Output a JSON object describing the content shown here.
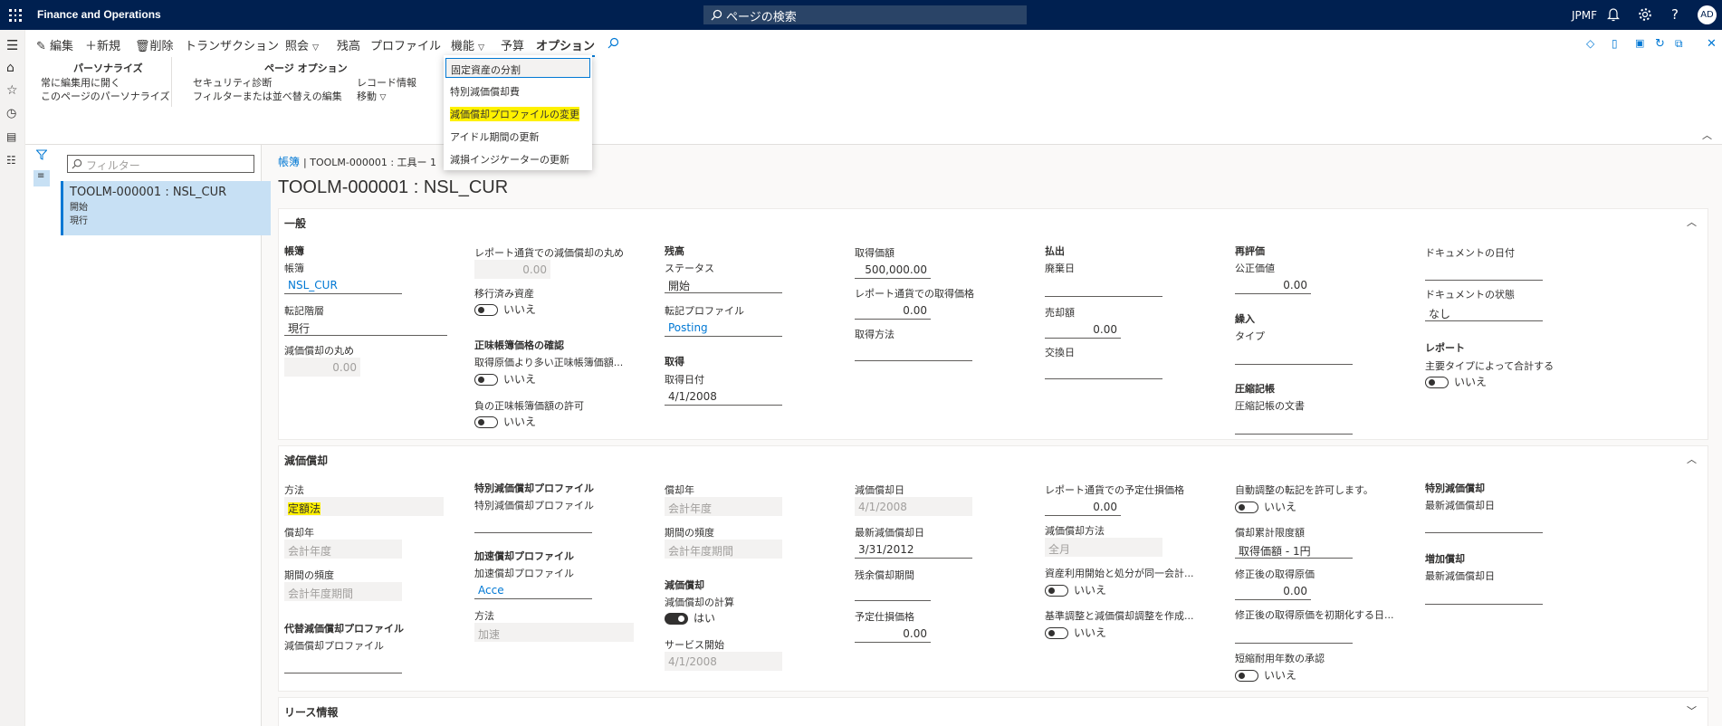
{
  "topbar": {
    "app_name": "Finance and Operations",
    "search_placeholder": "ページの検索",
    "company": "JPMF",
    "avatar": "AD"
  },
  "actions": {
    "edit": "編集",
    "new": "新規",
    "delete": "削除",
    "transaction": "トランザクション",
    "inquiry": "照会",
    "balance": "残高",
    "profile": "プロファイル",
    "function": "機能",
    "budget": "予算",
    "options": "オプション"
  },
  "options_pane": {
    "personalize_title": "パーソナライズ",
    "always_open_edit": "常に編集用に開く",
    "personalize_page": "このページのパーソナライズ",
    "page_options_title": "ページ オプション",
    "security_diagnostics": "セキュリティ診断",
    "filter_sort": "フィルターまたは並べ替えの編集",
    "record_info": "レコード情報",
    "move": "移動"
  },
  "function_menu": {
    "items": [
      "固定資産の分割",
      "特別減価償却費",
      "減価償却プロファイルの変更",
      "アイドル期間の更新",
      "減損インジケーターの更新"
    ]
  },
  "list": {
    "filter_placeholder": "フィルター",
    "item_title": "TOOLM-000001 : NSL_CUR",
    "item_line1": "開始",
    "item_line2": "現行"
  },
  "breadcrumb": {
    "link": "帳簿",
    "path": "TOOLM-000001 : 工具ー 1"
  },
  "page_title": "TOOLM-000001 : NSL_CUR",
  "general": {
    "title": "一般",
    "book_group": "帳簿",
    "book_label": "帳簿",
    "book_value": "NSL_CUR",
    "posting_layer_label": "転記階層",
    "posting_layer_value": "現行",
    "dep_rounding_label": "減価償却の丸め",
    "dep_rounding_value": "0.00",
    "report_rounding_label": "レポート通貨での減価償却の丸め",
    "report_rounding_value": "0.00",
    "migrated_label": "移行済み資産",
    "migrated_value": "いいえ",
    "nbv_group": "正味帳簿価格の確認",
    "nbv_greater_label": "取得原価より多い正味帳簿価額...",
    "nbv_greater_value": "いいえ",
    "nbv_negative_label": "負の正味帳簿価額の許可",
    "nbv_negative_value": "いいえ",
    "balance_group": "残高",
    "status_label": "ステータス",
    "status_value": "開始",
    "posting_profile_label": "転記プロファイル",
    "posting_profile_value": "Posting",
    "acq_group": "取得",
    "acq_date_label": "取得日付",
    "acq_date_value": "4/1/2008",
    "acq_price_label": "取得価額",
    "acq_price_value": "500,000.00",
    "report_acq_price_label": "レポート通貨での取得価格",
    "report_acq_price_value": "0.00",
    "acq_method_label": "取得方法",
    "acq_method_value": "",
    "disposal_group": "払出",
    "scrap_date_label": "廃棄日",
    "sale_amount_label": "売却額",
    "sale_amount_value": "0.00",
    "exchange_date_label": "交換日",
    "reval_group": "再評価",
    "fair_value_label": "公正価値",
    "fair_value_value": "0.00",
    "transfer_group": "繰入",
    "type_label": "タイプ",
    "compress_group": "圧縮記帳",
    "compress_doc_label": "圧縮記帳の文書",
    "doc_date_label": "ドキュメントの日付",
    "doc_status_label": "ドキュメントの状態",
    "doc_status_value": "なし",
    "report_group": "レポート",
    "sum_by_main_type_label": "主要タイプによって合計する",
    "sum_by_main_type_value": "いいえ"
  },
  "depreciation": {
    "title": "減価償却",
    "method_label": "方法",
    "method_value": "定額法",
    "dep_year_label": "償却年",
    "dep_year_value": "会計年度",
    "period_freq_label": "期間の頻度",
    "period_freq_value": "会計年度期間",
    "alt_group": "代替減価償却プロファイル",
    "alt_profile_label": "減価償却プロファイル",
    "special_group": "特別減価償却プロファイル",
    "special_profile_label": "特別減価償却プロファイル",
    "accel_group": "加速償却プロファイル",
    "accel_profile_label": "加速償却プロファイル",
    "accel_profile_value": "Acce",
    "accel_method_label": "方法",
    "accel_method_value": "加速",
    "dep_year2_label": "償却年",
    "dep_year2_value": "会計年度",
    "period_freq2_label": "期間の頻度",
    "period_freq2_value": "会計年度期間",
    "dep_group": "減価償却",
    "calc_dep_label": "減価償却の計算",
    "calc_dep_value": "はい",
    "service_start_label": "サービス開始",
    "service_start_value": "4/1/2008",
    "dep_date_label": "減価償却日",
    "dep_date_value": "4/1/2008",
    "last_dep_date_label": "最新減価償却日",
    "last_dep_date_value": "3/31/2012",
    "remaining_periods_label": "残余償却期間",
    "remaining_periods_value": "",
    "scrap_value_label": "予定仕損価格",
    "scrap_value_value": "0.00",
    "report_scrap_label": "レポート通貨での予定仕損価格",
    "report_scrap_value": "0.00",
    "dep_convention_label": "減価償却方法",
    "dep_convention_value": "全月",
    "same_period_label": "資産利用開始と処分が同一会計...",
    "same_period_value": "いいえ",
    "equity_adj_label": "基準調整と減価償却調整を作成...",
    "equity_adj_value": "いいえ",
    "auto_adj_label": "自動調整の転記を許可します。",
    "auto_adj_value": "いいえ",
    "max_dep_label": "償却累計限度額",
    "max_dep_value": "取得価額 - 1円",
    "revised_acq_label": "修正後の取得原価",
    "revised_acq_value": "0.00",
    "revised_init_label": "修正後の取得原価を初期化する日...",
    "short_life_label": "短縮耐用年数の承認",
    "short_life_value": "いいえ",
    "special_dep_group": "特別減価償却",
    "special_last_date_label": "最新減価償却日",
    "extra_dep_group": "増加償却",
    "extra_last_date_label": "最新減価償却日"
  },
  "lease": {
    "title": "リース情報"
  }
}
